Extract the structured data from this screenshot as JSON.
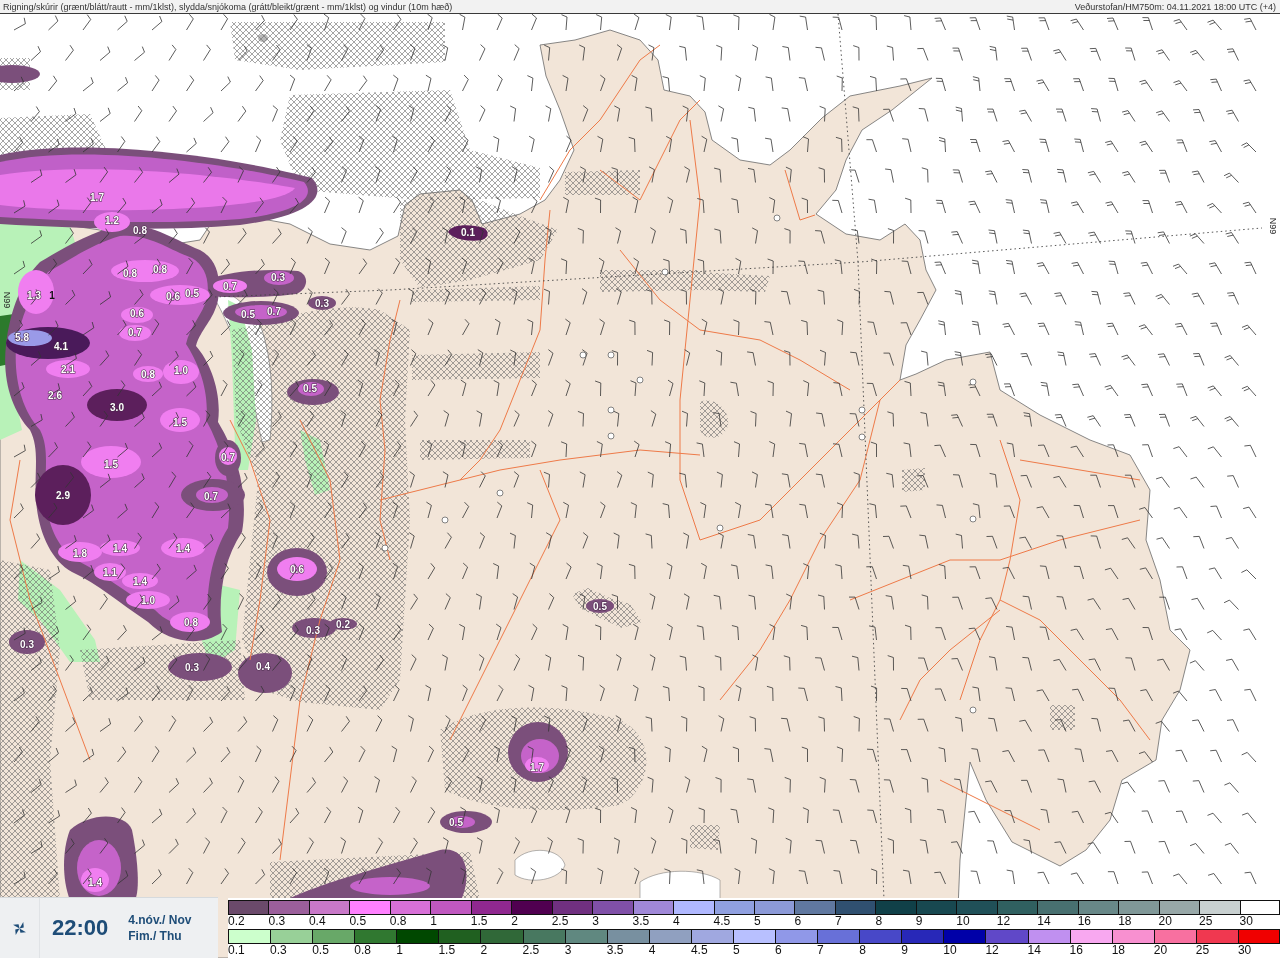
{
  "header": {
    "title": "Rigning/skúrir (grænt/blátt/rautt - mm/1klst), slydda/snjókoma (grátt/bleikt/grænt - mm/1klst) og vindur (10m hæð)",
    "source": "Veðurstofan/HM750m: 04.11.2021 18:00 UTC (+4)"
  },
  "map": {
    "latitude_labels": [
      "66N",
      "66N"
    ],
    "precipitation_values": [
      "1.7",
      "1.2",
      "0.8",
      "0.1",
      "0.8",
      "0.8",
      "1.3",
      "1",
      "0.6",
      "0.5",
      "0.7",
      "0.3",
      "0.6",
      "0.5",
      "0.7",
      "0.3",
      "5.8",
      "4.1",
      "0.7",
      "2.1",
      "0.8",
      "1.0",
      "2.6",
      "3.0",
      "0.5",
      "1.5",
      "0.7",
      "1.5",
      "2.9",
      "0.7",
      "1.8",
      "1.4",
      "1.4",
      "1.1",
      "1.4",
      "1.0",
      "0.6",
      "0.8",
      "0.3",
      "0.3",
      "0.2",
      "0.3",
      "0.4",
      "0.5",
      "1.7",
      "0.5",
      "1.4"
    ]
  },
  "time_panel": {
    "time": "22:00",
    "date": "4.nóv./ Nov",
    "weekday": "Fim./ Thu"
  },
  "legend": {
    "rows": [
      {
        "items": [
          {
            "label": "0.2",
            "color": "#6b4a6b"
          },
          {
            "label": "0.3",
            "color": "#9b5f9b"
          },
          {
            "label": "0.4",
            "color": "#c878c8"
          },
          {
            "label": "0.5",
            "color": "#ff80ff"
          },
          {
            "label": "0.8",
            "color": "#d870d8"
          },
          {
            "label": "1",
            "color": "#c058c0"
          },
          {
            "label": "1.5",
            "color": "#902890"
          },
          {
            "label": "2",
            "color": "#500050"
          },
          {
            "label": "2.5",
            "color": "#703080"
          },
          {
            "label": "3",
            "color": "#8050a8"
          },
          {
            "label": "3.5",
            "color": "#a088d8"
          },
          {
            "label": "4",
            "color": "#b0b8ff"
          },
          {
            "label": "4.5",
            "color": "#90a0e0"
          },
          {
            "label": "5",
            "color": "#8c9ad8"
          },
          {
            "label": "6",
            "color": "#6078a0"
          },
          {
            "label": "7",
            "color": "#305070"
          },
          {
            "label": "8",
            "color": "#104048"
          },
          {
            "label": "9",
            "color": "#184850"
          },
          {
            "label": "10",
            "color": "#205058"
          },
          {
            "label": "12",
            "color": "#306060"
          },
          {
            "label": "14",
            "color": "#487070"
          },
          {
            "label": "16",
            "color": "#688888"
          },
          {
            "label": "18",
            "color": "#809898"
          },
          {
            "label": "20",
            "color": "#98a8a8"
          },
          {
            "label": "25",
            "color": "#c8d0d0"
          },
          {
            "label": "30",
            "color": "#ffffff"
          }
        ]
      },
      {
        "items": [
          {
            "label": "0.1",
            "color": "#ccffcc"
          },
          {
            "label": "0.3",
            "color": "#98d098"
          },
          {
            "label": "0.5",
            "color": "#68a868"
          },
          {
            "label": "0.8",
            "color": "#307830"
          },
          {
            "label": "1",
            "color": "#004800"
          },
          {
            "label": "1.5",
            "color": "#206020"
          },
          {
            "label": "2",
            "color": "#306838"
          },
          {
            "label": "2.5",
            "color": "#487860"
          },
          {
            "label": "3",
            "color": "#608880"
          },
          {
            "label": "3.5",
            "color": "#7890a0"
          },
          {
            "label": "4",
            "color": "#90a0c0"
          },
          {
            "label": "4.5",
            "color": "#a0a8e0"
          },
          {
            "label": "5",
            "color": "#b8c0ff"
          },
          {
            "label": "6",
            "color": "#9098e8"
          },
          {
            "label": "7",
            "color": "#6870d8"
          },
          {
            "label": "8",
            "color": "#4848c8"
          },
          {
            "label": "9",
            "color": "#2828b8"
          },
          {
            "label": "10",
            "color": "#0000a8"
          },
          {
            "label": "12",
            "color": "#6048c8"
          },
          {
            "label": "14",
            "color": "#c090f0"
          },
          {
            "label": "16",
            "color": "#f8a8f0"
          },
          {
            "label": "18",
            "color": "#f890d0"
          },
          {
            "label": "20",
            "color": "#f870a0"
          },
          {
            "label": "25",
            "color": "#f03850"
          },
          {
            "label": "30",
            "color": "#f00000"
          }
        ]
      }
    ]
  }
}
